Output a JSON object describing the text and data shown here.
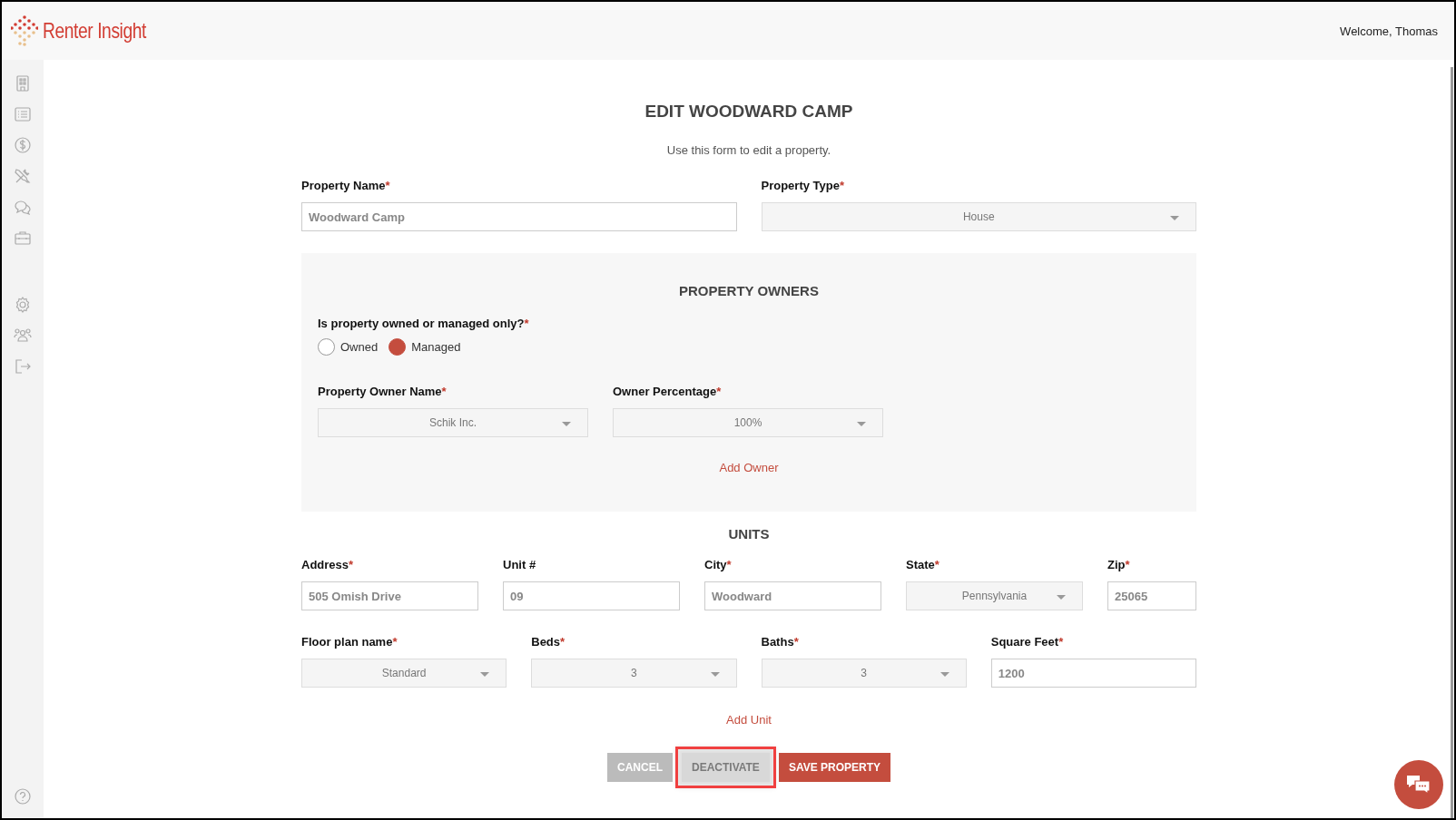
{
  "header": {
    "logo_text": "Renter Insight",
    "welcome": "Welcome, Thomas"
  },
  "form": {
    "title": "EDIT WOODWARD CAMP",
    "subtitle": "Use this form to edit a property.",
    "top_fields": [
      {
        "kind": "input",
        "label": "Property Name",
        "mark": "*",
        "value": "Woodward Camp"
      },
      {
        "kind": "select",
        "label": "Property Type",
        "mark": "*",
        "value": "House"
      }
    ],
    "owners": {
      "title": "PROPERTY OWNERS",
      "question": "Is property owned or managed only?",
      "question_mark": "*",
      "radios": [
        {
          "label": "Owned",
          "selected": false
        },
        {
          "label": "Managed",
          "selected": true
        }
      ],
      "fields": [
        {
          "kind": "select",
          "label": "Property Owner Name",
          "mark": "*",
          "value": "Schik Inc."
        },
        {
          "kind": "select",
          "label": "Owner Percentage",
          "mark": "*",
          "value": "100%"
        }
      ],
      "add_link": "Add Owner"
    },
    "units": {
      "title": "UNITS",
      "row_1": [
        {
          "kind": "input",
          "label": "Address",
          "mark": "*",
          "value": "505 Omish Drive"
        },
        {
          "kind": "input",
          "label": "Unit #",
          "value": "09"
        },
        {
          "kind": "input",
          "label": "City",
          "mark": "*",
          "value": "Woodward"
        },
        {
          "kind": "select",
          "label": "State",
          "mark": "*",
          "value": "Pennsylvania"
        },
        {
          "kind": "input",
          "label": "Zip",
          "mark": "*",
          "value": "25065"
        }
      ],
      "row_2": [
        {
          "kind": "select",
          "label": "Floor plan name",
          "mark": "*",
          "value": "Standard"
        },
        {
          "kind": "select",
          "label": "Beds",
          "mark": "*",
          "value": "3"
        },
        {
          "kind": "select",
          "label": "Baths",
          "mark": "*",
          "value": "3"
        },
        {
          "kind": "input",
          "label": "Square Feet",
          "mark": "*",
          "value": "1200"
        }
      ],
      "add_link": "Add Unit"
    },
    "buttons": [
      {
        "label": "CANCEL",
        "kind": "cancel",
        "highlighted": false
      },
      {
        "label": "DEACTIVATE",
        "kind": "disabled",
        "highlighted": true
      },
      {
        "label": "SAVE PROPERTY",
        "kind": "primary",
        "highlighted": false
      }
    ]
  }
}
